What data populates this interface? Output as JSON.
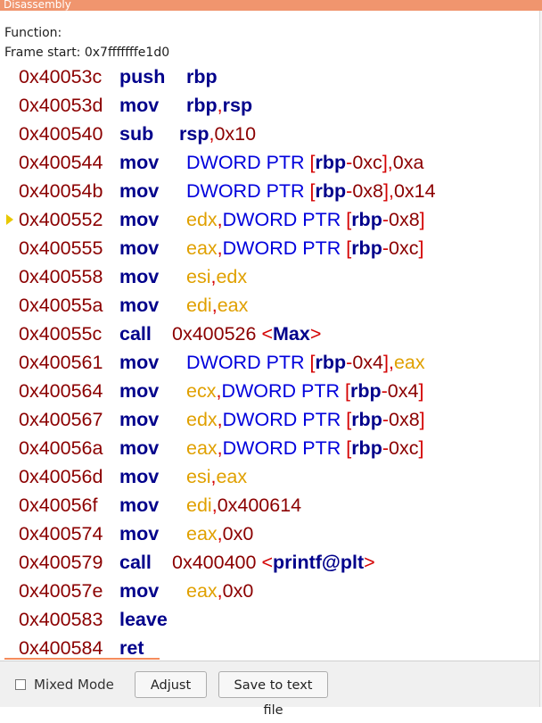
{
  "window": {
    "title": "Disassembly"
  },
  "info": {
    "function_label": "Function:",
    "frame_start": "Frame start: 0x7fffffffe1d0"
  },
  "colors": {
    "title_bar": "#f0956e",
    "address": "#8b0000",
    "mnemonic": "#00008b",
    "register": "#00008b",
    "memory": "#0000dd",
    "number": "#8b0000",
    "punctuation": "#d40000",
    "highlight_register": "#e0a000",
    "current_marker": "#e8c800"
  },
  "current_line_index": 5,
  "instructions": [
    {
      "address": "0x40053c",
      "mnemonic": "push",
      "operands": [
        {
          "t": "rbp",
          "c": "reg"
        }
      ]
    },
    {
      "address": "0x40053d",
      "mnemonic": "mov",
      "operands": [
        {
          "t": "rbp",
          "c": "reg"
        },
        {
          "t": ",",
          "c": "punc"
        },
        {
          "t": "rsp",
          "c": "reg"
        }
      ]
    },
    {
      "address": "0x400540",
      "mnemonic": "sub",
      "operands": [
        {
          "t": "rsp",
          "c": "reg"
        },
        {
          "t": ",",
          "c": "punc"
        },
        {
          "t": "0x10",
          "c": "num"
        }
      ]
    },
    {
      "address": "0x400544",
      "mnemonic": "mov",
      "operands": [
        {
          "t": "DWORD PTR ",
          "c": "ptr"
        },
        {
          "t": "[",
          "c": "punc"
        },
        {
          "t": "rbp",
          "c": "reg"
        },
        {
          "t": "-",
          "c": "punc"
        },
        {
          "t": "0xc",
          "c": "num"
        },
        {
          "t": "],",
          "c": "punc"
        },
        {
          "t": "0xa",
          "c": "num"
        }
      ]
    },
    {
      "address": "0x40054b",
      "mnemonic": "mov",
      "operands": [
        {
          "t": "DWORD PTR ",
          "c": "ptr"
        },
        {
          "t": "[",
          "c": "punc"
        },
        {
          "t": "rbp",
          "c": "reg"
        },
        {
          "t": "-",
          "c": "punc"
        },
        {
          "t": "0x8",
          "c": "num"
        },
        {
          "t": "],",
          "c": "punc"
        },
        {
          "t": "0x14",
          "c": "num"
        }
      ]
    },
    {
      "address": "0x400552",
      "mnemonic": "mov",
      "operands": [
        {
          "t": "edx",
          "c": "reg2"
        },
        {
          "t": ",",
          "c": "punc"
        },
        {
          "t": "DWORD PTR ",
          "c": "ptr"
        },
        {
          "t": "[",
          "c": "punc"
        },
        {
          "t": "rbp",
          "c": "reg"
        },
        {
          "t": "-",
          "c": "punc"
        },
        {
          "t": "0x8",
          "c": "num"
        },
        {
          "t": "]",
          "c": "punc"
        }
      ]
    },
    {
      "address": "0x400555",
      "mnemonic": "mov",
      "operands": [
        {
          "t": "eax",
          "c": "reg2"
        },
        {
          "t": ",",
          "c": "punc"
        },
        {
          "t": "DWORD PTR ",
          "c": "ptr"
        },
        {
          "t": "[",
          "c": "punc"
        },
        {
          "t": "rbp",
          "c": "reg"
        },
        {
          "t": "-",
          "c": "punc"
        },
        {
          "t": "0xc",
          "c": "num"
        },
        {
          "t": "]",
          "c": "punc"
        }
      ]
    },
    {
      "address": "0x400558",
      "mnemonic": "mov",
      "operands": [
        {
          "t": "esi",
          "c": "reg2"
        },
        {
          "t": ",",
          "c": "punc"
        },
        {
          "t": "edx",
          "c": "reg2"
        }
      ]
    },
    {
      "address": "0x40055a",
      "mnemonic": "mov",
      "operands": [
        {
          "t": "edi",
          "c": "reg2"
        },
        {
          "t": ",",
          "c": "punc"
        },
        {
          "t": "eax",
          "c": "reg2"
        }
      ]
    },
    {
      "address": "0x40055c",
      "mnemonic": "call",
      "operands": [
        {
          "t": "0x400526 ",
          "c": "num"
        },
        {
          "t": "<",
          "c": "punc"
        },
        {
          "t": "Max",
          "c": "sym"
        },
        {
          "t": ">",
          "c": "punc"
        }
      ]
    },
    {
      "address": "0x400561",
      "mnemonic": "mov",
      "operands": [
        {
          "t": "DWORD PTR ",
          "c": "ptr"
        },
        {
          "t": "[",
          "c": "punc"
        },
        {
          "t": "rbp",
          "c": "reg"
        },
        {
          "t": "-",
          "c": "punc"
        },
        {
          "t": "0x4",
          "c": "num"
        },
        {
          "t": "],",
          "c": "punc"
        },
        {
          "t": "eax",
          "c": "reg2"
        }
      ]
    },
    {
      "address": "0x400564",
      "mnemonic": "mov",
      "operands": [
        {
          "t": "ecx",
          "c": "reg2"
        },
        {
          "t": ",",
          "c": "punc"
        },
        {
          "t": "DWORD PTR ",
          "c": "ptr"
        },
        {
          "t": "[",
          "c": "punc"
        },
        {
          "t": "rbp",
          "c": "reg"
        },
        {
          "t": "-",
          "c": "punc"
        },
        {
          "t": "0x4",
          "c": "num"
        },
        {
          "t": "]",
          "c": "punc"
        }
      ]
    },
    {
      "address": "0x400567",
      "mnemonic": "mov",
      "operands": [
        {
          "t": "edx",
          "c": "reg2"
        },
        {
          "t": ",",
          "c": "punc"
        },
        {
          "t": "DWORD PTR ",
          "c": "ptr"
        },
        {
          "t": "[",
          "c": "punc"
        },
        {
          "t": "rbp",
          "c": "reg"
        },
        {
          "t": "-",
          "c": "punc"
        },
        {
          "t": "0x8",
          "c": "num"
        },
        {
          "t": "]",
          "c": "punc"
        }
      ]
    },
    {
      "address": "0x40056a",
      "mnemonic": "mov",
      "operands": [
        {
          "t": "eax",
          "c": "reg2"
        },
        {
          "t": ",",
          "c": "punc"
        },
        {
          "t": "DWORD PTR ",
          "c": "ptr"
        },
        {
          "t": "[",
          "c": "punc"
        },
        {
          "t": "rbp",
          "c": "reg"
        },
        {
          "t": "-",
          "c": "punc"
        },
        {
          "t": "0xc",
          "c": "num"
        },
        {
          "t": "]",
          "c": "punc"
        }
      ]
    },
    {
      "address": "0x40056d",
      "mnemonic": "mov",
      "operands": [
        {
          "t": "esi",
          "c": "reg2"
        },
        {
          "t": ",",
          "c": "punc"
        },
        {
          "t": "eax",
          "c": "reg2"
        }
      ]
    },
    {
      "address": "0x40056f",
      "mnemonic": "mov",
      "operands": [
        {
          "t": "edi",
          "c": "reg2"
        },
        {
          "t": ",",
          "c": "punc"
        },
        {
          "t": "0x400614",
          "c": "num"
        }
      ]
    },
    {
      "address": "0x400574",
      "mnemonic": "mov",
      "operands": [
        {
          "t": "eax",
          "c": "reg2"
        },
        {
          "t": ",",
          "c": "punc"
        },
        {
          "t": "0x0",
          "c": "num"
        }
      ]
    },
    {
      "address": "0x400579",
      "mnemonic": "call",
      "operands": [
        {
          "t": "0x400400 ",
          "c": "num"
        },
        {
          "t": "<",
          "c": "punc"
        },
        {
          "t": "printf@plt",
          "c": "sym"
        },
        {
          "t": ">",
          "c": "punc"
        }
      ]
    },
    {
      "address": "0x40057e",
      "mnemonic": "mov",
      "operands": [
        {
          "t": "eax",
          "c": "reg2"
        },
        {
          "t": ",",
          "c": "punc"
        },
        {
          "t": "0x0",
          "c": "num"
        }
      ]
    },
    {
      "address": "0x400583",
      "mnemonic": "leave",
      "operands": []
    },
    {
      "address": "0x400584",
      "mnemonic": "ret",
      "operands": []
    }
  ],
  "controls": {
    "mixed_mode_label": "Mixed Mode",
    "mixed_mode_checked": false,
    "adjust_label": "Adjust",
    "save_label": "Save to text file"
  }
}
